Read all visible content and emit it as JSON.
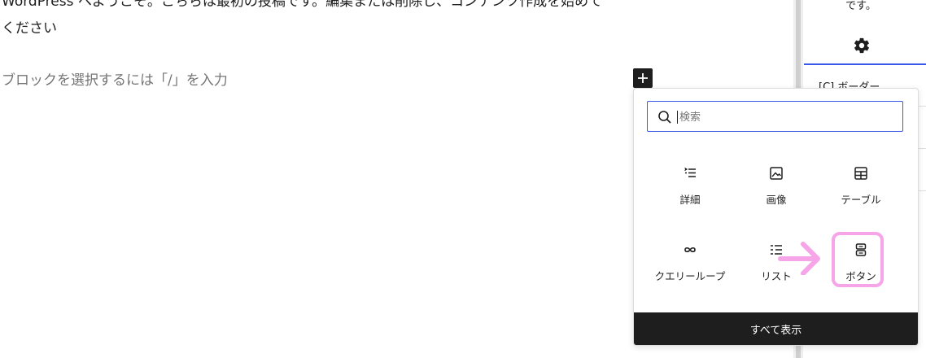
{
  "editor": {
    "paragraph_line1": "WordPress へようこそ。こちらは最初の投稿です。編集または削除し、コンテンツ作成を始めて",
    "paragraph_line2": "ください",
    "block_placeholder": "ブロックを選択するには「/」を入力"
  },
  "sidebar": {
    "top_text": "です。",
    "settings_icon": "gear-icon",
    "border_label": "[C] ボーダー",
    "accent": "#3858e9"
  },
  "inserter": {
    "toggle_icon": "plus-icon",
    "search": {
      "value": "",
      "placeholder": "検索",
      "icon": "search-icon"
    },
    "blocks": [
      {
        "label": "詳細",
        "icon": "details-icon"
      },
      {
        "label": "画像",
        "icon": "image-icon"
      },
      {
        "label": "テーブル",
        "icon": "table-icon"
      },
      {
        "label": "クエリーループ",
        "icon": "loop-icon"
      },
      {
        "label": "リスト",
        "icon": "list-icon"
      },
      {
        "label": "ボタン",
        "icon": "buttons-icon"
      }
    ],
    "browse_all": "すべて表示"
  },
  "annotation": {
    "highlight_color": "#f6a5e8",
    "arrow_icon": "arrow-right-icon"
  }
}
